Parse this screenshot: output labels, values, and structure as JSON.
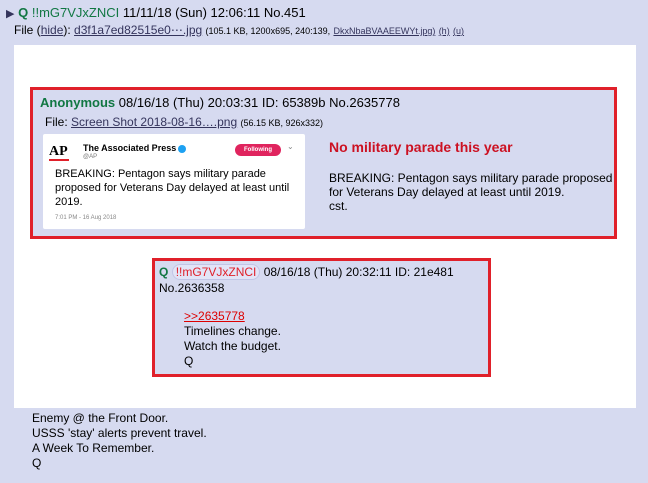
{
  "header": {
    "name": "Q",
    "tripcode": "!!mG7VJxZNCI",
    "datetime": "11/11/18 (Sun) 12:06:11",
    "post_no": "No.451"
  },
  "file_line": {
    "label": "File",
    "hide": "hide",
    "filename": "d3f1a7ed82515e0⋯.jpg",
    "meta": "(105.1 KB, 1200x695, 240:139,",
    "orig_name": "DkxNbaBVAAEEWYt.jpg)",
    "h": "(h)",
    "u": "(u)"
  },
  "quoted_post": {
    "name": "Anonymous",
    "datetime": "08/16/18 (Thu) 20:03:31",
    "id": "ID: 65389b",
    "post_no": "No.2635778",
    "file_label": "File:",
    "file_link": "Screen Shot 2018-08-16….png",
    "file_meta": "(56.15 KB, 926x332)",
    "tweet": {
      "logo": "AP",
      "account": "The Associated Press",
      "handle": "@AP",
      "follow": "Following",
      "text": "BREAKING: Pentagon says military parade proposed for Veterans Day delayed at least until 2019.",
      "time": "7:01 PM - 16 Aug 2018"
    },
    "red_title": "No military parade this year",
    "body": "BREAKING: Pentagon says military parade proposed for Veterans Day delayed at least until 2019.",
    "body_sig": "cst."
  },
  "q_post": {
    "name": "Q",
    "tripcode": "!!mG7VJxZNCI",
    "datetime": "08/16/18 (Thu) 20:32:11",
    "id": "ID: 21e481",
    "post_no": "No.2636358",
    "quote_link": ">>2635778",
    "line1": "Timelines change.",
    "line2": "Watch the budget.",
    "line3": "Q"
  },
  "footer": {
    "line1": "Enemy @ the Front Door.",
    "line2": "USSS 'stay' alerts prevent travel.",
    "line3": "A Week To Remember.",
    "line4": "Q"
  }
}
